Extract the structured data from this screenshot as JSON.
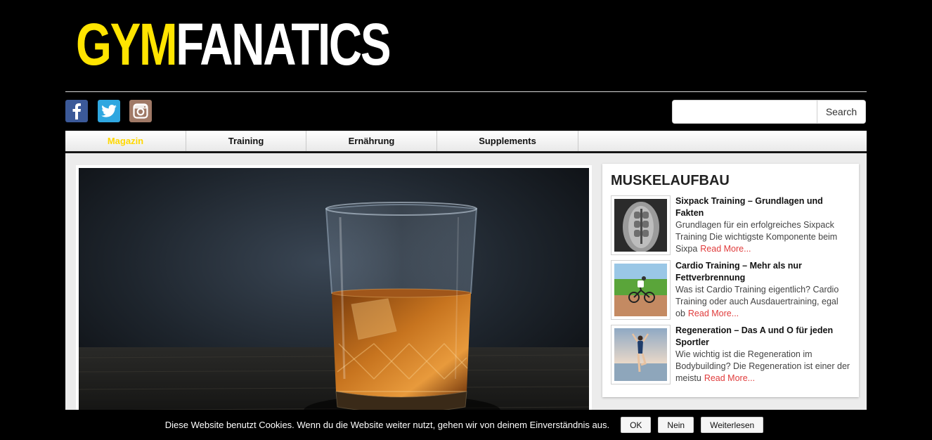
{
  "logo": {
    "part1": "GYM",
    "part2": "FANATICS"
  },
  "social": [
    {
      "name": "facebook",
      "icon": "facebook-icon",
      "color": "#3b5998"
    },
    {
      "name": "twitter",
      "icon": "twitter-icon",
      "color": "#2fa7e0"
    },
    {
      "name": "instagram",
      "icon": "instagram-icon",
      "color": "#a07966"
    }
  ],
  "search": {
    "placeholder": "",
    "value": "",
    "button_label": "Search"
  },
  "nav": {
    "items": [
      {
        "label": "Magazin",
        "active": true
      },
      {
        "label": "Training",
        "active": false
      },
      {
        "label": "Ernährung",
        "active": false
      },
      {
        "label": "Supplements",
        "active": false
      }
    ],
    "active_color": "#ffd800"
  },
  "hero": {
    "image": "whisky-glass-photo"
  },
  "sidebar": {
    "title": "MUSKELAUFBAU",
    "posts": [
      {
        "title": "Sixpack Training – Grundlagen und Fakten",
        "excerpt": "Grundlagen für ein erfolgreiches Sixpack Training Die wichtigste Komponente beim Sixpa",
        "read_more": "Read More...",
        "thumb": "abs-photo"
      },
      {
        "title": "Cardio Training – Mehr als nur Fettverbrennung",
        "excerpt": "Was ist Cardio Training eigentlich? Cardio Training oder auch Ausdauertraining, egal ob",
        "read_more": "Read More...",
        "thumb": "cyclist-photo"
      },
      {
        "title": "Regeneration – Das A und O für jeden Sportler",
        "excerpt": "Wie wichtig ist die Regeneration im Bodybuilding? Die Regeneration ist einer der meistu",
        "read_more": "Read More...",
        "thumb": "yoga-beach-photo"
      }
    ],
    "read_more_color": "#e03b3b"
  },
  "cookie": {
    "text": "Diese Website benutzt Cookies. Wenn du die Website weiter nutzt, gehen wir von deinem Einverständnis aus.",
    "ok_label": "OK",
    "no_label": "Nein",
    "more_label": "Weiterlesen"
  }
}
